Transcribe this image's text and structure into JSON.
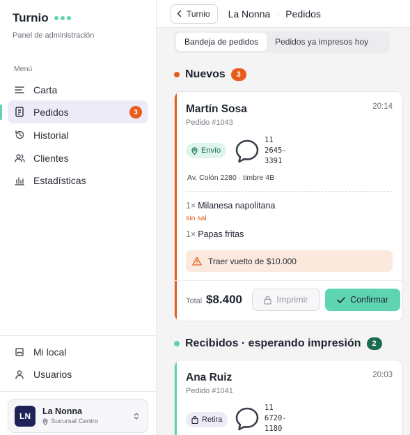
{
  "sidebar": {
    "brand": "Turnio",
    "subtitle": "Panel de administración",
    "menu_label": "Menú",
    "items": [
      {
        "label": "Carta",
        "icon": "list-icon"
      },
      {
        "label": "Pedidos",
        "icon": "receipt-icon",
        "badge": "3",
        "active": true
      },
      {
        "label": "Historial",
        "icon": "history-icon"
      },
      {
        "label": "Clientes",
        "icon": "users-icon"
      },
      {
        "label": "Estadísticas",
        "icon": "bar-chart-icon"
      }
    ],
    "bottom_items": [
      {
        "label": "Mi local",
        "icon": "store-icon"
      },
      {
        "label": "Usuarios",
        "icon": "user-icon"
      }
    ],
    "account": {
      "initials": "LN",
      "name": "La Nonna",
      "branch": "Sucursal Centro"
    }
  },
  "header": {
    "back_label": "Turnio",
    "crumb_1": "La Nonna",
    "crumb_sep": "·",
    "crumb_2": "Pedidos"
  },
  "tabs": [
    "Bandeja de pedidos",
    "Pedidos ya impresos hoy"
  ],
  "sections": {
    "new": {
      "title": "Nuevos",
      "count": "3",
      "color": "#e85d1b"
    },
    "received": {
      "title": "Recibidos · esperando impresión",
      "count": "2",
      "color": "#1d6b4f"
    }
  },
  "orders": [
    {
      "name": "Martín Sosa",
      "number": "Pedido #1043",
      "time": "20:14",
      "mode": "Envío",
      "phone": "11\n2645-\n3391",
      "address": "Av. Colón 2280 · timbre 4B",
      "items": [
        {
          "qty": "1×",
          "name": "Milanesa napolitana",
          "note": "sin sal"
        },
        {
          "qty": "1×",
          "name": "Papas fritas"
        }
      ],
      "alert": "Traer vuelto de $10.000",
      "total_label": "Total",
      "total": "$8.400",
      "print_label": "Imprimir",
      "confirm_label": "Confirmar"
    },
    {
      "name": "Ana Ruiz",
      "number": "Pedido #1041",
      "time": "20:03",
      "mode": "Retira",
      "phone": "11\n6720-\n1180"
    }
  ],
  "colors": {
    "accent": "#5fd4b1",
    "urgent": "#e85d1b",
    "brand_navy": "#1e2257"
  }
}
